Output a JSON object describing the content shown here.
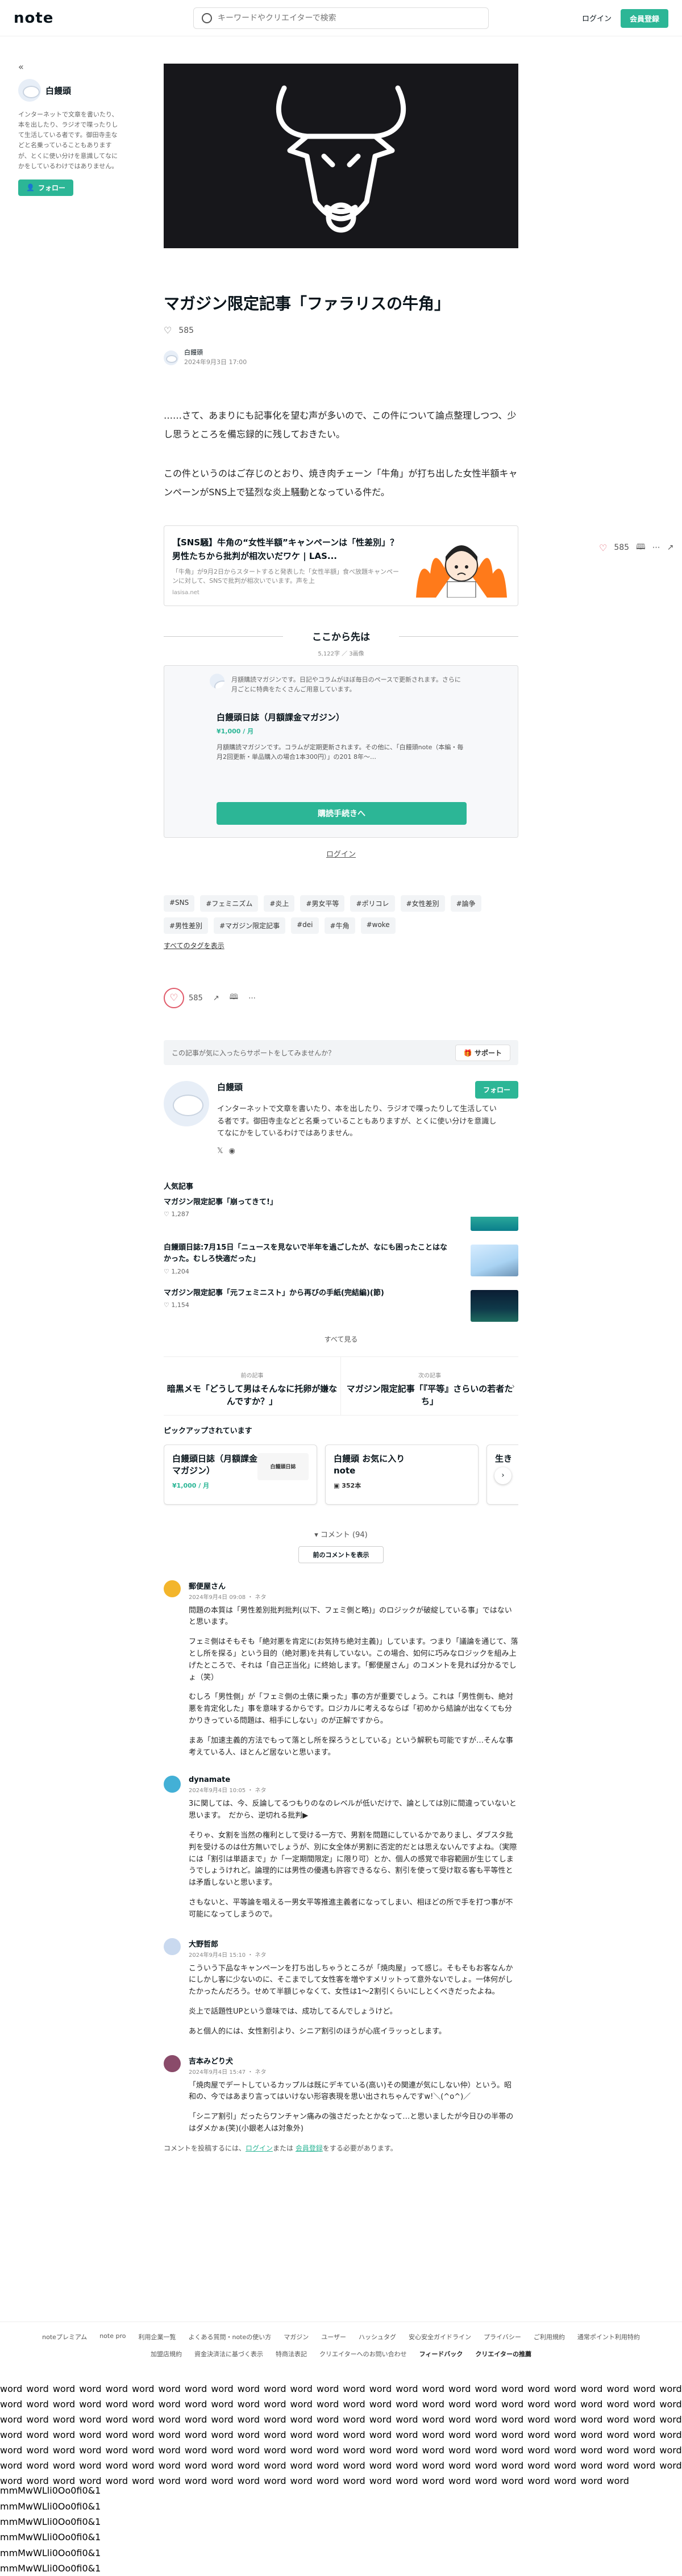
{
  "header": {
    "logo": "note",
    "search_placeholder": "キーワードやクリエイターで検索",
    "login": "ログイン",
    "register": "会員登録"
  },
  "sidebar": {
    "name": "白饅頭",
    "description": "インターネットで文章を書いたり、本を出したり、ラジオで喋ったりして生活している者です。御田寺圭などと名乗っていることもありますが、とくに使い分けを意識してなにかをしているわけではありません。",
    "follow": "フォロー"
  },
  "article": {
    "title": "マガジン限定記事「ファラリスの牛角」",
    "likes": "585",
    "author": "白饅頭",
    "date": "2024年9月3日 17:00",
    "paragraphs": [
      "……さて、あまりにも記事化を望む声が多いので、この件について論点整理しつつ、少し思うところを備忘録的に残しておきたい。",
      "この件というのはご存じのとおり、焼き肉チェーン「牛角」が打ち出した女性半額キャンペーンがSNS上で猛烈な炎上騒動となっている件だ。"
    ]
  },
  "embed": {
    "title": "【SNS騒】牛角の“女性半額”キャンペーンは「性差別」？ 男性たちから批判が相次いだワケ | LAS...",
    "description": "「牛角」が9月2日からスタートすると発表した「女性半額」食べ放題キャンペーンに対して、SNSで批判が相次いでいます。声を上",
    "source": "lasisa.net"
  },
  "paywall": {
    "title": "ここから先は",
    "stats": "5,122字 ／ 3画像",
    "note": "月額購読マガジンです。日記やコラムがほぼ毎日のペースで更新されます。さらに月ごとに特典をたくさんご用意しています。",
    "magazine_name": "白饅頭日誌（月額課金マガジン）",
    "price": "¥1,000 / 月",
    "magazine_desc": "月額購読マガジンです。コラムが定期更新されます。その他に、「白饅頭note（本編・毎月2回更新・単品購入の場合1本300円）」の201 8年～…",
    "subscribe": "購読手続きへ",
    "login": "ログイン"
  },
  "tags": [
    "#SNS",
    "#フェミニズム",
    "#炎上",
    "#男女平等",
    "#ポリコレ",
    "#女性差別",
    "#論争",
    "#男性差別",
    "#マガジン限定記事",
    "#dei",
    "#牛角",
    "#woke"
  ],
  "all_tags": "すべてのタグを表示",
  "actions": {
    "likes": "585"
  },
  "support": {
    "text": "この記事が気に入ったらサポートをしてみませんか？",
    "button": "サポート"
  },
  "creator": {
    "name": "白饅頭",
    "description": "インターネットで文章を書いたり、本を出したり、ラジオで喋ったりして生活している者です。御田寺圭などと名乗っていることもありますが、とくに使い分けを意識してなにかをしているわけではありません。",
    "follow": "フォロー"
  },
  "popular": {
    "title": "人気記事",
    "items": [
      {
        "title": "マガジン限定記事「崩ってきて!」",
        "likes": "1,287"
      },
      {
        "title": "白饅頭日誌:7月15日「ニュースを見ないで半年を過ごしたが、なにも困ったことはなかった。むしろ快適だった」",
        "likes": "1,204"
      },
      {
        "title": "マガジン限定記事「元フェミニスト」から再びの手紙(完結編)(節)",
        "likes": "1,154"
      }
    ],
    "see_all": "すべて見る"
  },
  "prevnext": {
    "prev_label": "前の記事",
    "prev_title": "暗黒メモ「どうして男はそんなに托卵が嫌なんですか？」",
    "next_label": "次の記事",
    "next_title": "マガジン限定記事「『平等』さらいの若者たち」"
  },
  "pickup": {
    "title": "ピックアップされています",
    "items": [
      {
        "title": "白饅頭日誌（月額課金マガジン）",
        "meta": "¥1,000 / 月",
        "thumb": "白饅頭日誌"
      },
      {
        "title": "白饅頭 お気に入りnote",
        "meta": "352本",
        "thumb": ""
      },
      {
        "title": "生き",
        "meta": "",
        "thumb": ""
      }
    ]
  },
  "comments": {
    "header": "コメント (94)",
    "prev": "前のコメントを表示",
    "items": [
      {
        "name": "郵便屋さん",
        "date": "2024年9月4日 09:08 ・ ネタ",
        "body": [
          "問題の本質は「男性差別批判批判(以下、フェミ側と略)」のロジックが破綻している事」ではないと思います。",
          "フェミ側はそもそも「絶対悪を肯定に(お気持ち絶対主義)」しています。つまり「議論を通じて、落とし所を探る」という目的（絶対悪)を共有していない。この場合、如何に巧みなロジックを組み上げたところで、それは「自己正当化」に終始します。「郵便屋さん」のコメントを見れば分かるでしょ（笑）",
          "むしろ「男性側」が「フェミ側の土俵に乗った」事の方が重要でしょう。これは「男性側も、絶対悪を肯定化した」事を意味するからです。ロジカルに考えるならば「初めから結論が出なくても分かりきっている問題は、相手にしない」のが正解ですから。",
          "まあ「加速主義的方法でもって落とし所を探ろうとしている」という解釈も可能ですが…そんな事考えている人、ほとんど居ないと思います。"
        ]
      },
      {
        "name": "dynamate",
        "date": "2024年9月4日 10:05 ・ ネタ",
        "body": [
          "3に関しては、今、反論してるつもりのなのレベルが低いだけで、論としては別に間違っていないと思います。　だから、逆切れる批判▶",
          "そりゃ、女割を当然の権利として受ける一方で、男割を問題にしているかでありまし、ダブスタ批判を受けるのは仕方無いでしょうが、別に女全体が男割に否定的だとは思えないんですよね。（実際には「割引は単語まで」か「一定期間限定」に限り可）とか、個人の感覚で非容範囲が生じてしまうでしょうけれど。論理的には男性の優遇も許容できるなら、割引を使って受け取る客も平等性とは矛盾しないと思います。",
          "さもないと、平等論を唱える一男女平等推進主義者になってしまい、相ほどの所で手を打つ事が不可能になってしまうので。"
        ]
      },
      {
        "name": "大野哲郎",
        "date": "2024年9月4日 15:10 ・ ネタ",
        "body": [
          "こういう下品なキャンペーンを打ち出しちゃうところが「焼肉屋」って感じ。そもそもお客なんかにしかし客に少ないのに、そこまでして女性客を増やすメリットって意外ないでしょ。一体何がしたかったんだろう。せめて半額じゃなくて、女性は1〜2割引くらいにしとくべきだったよね。",
          "炎上で話題性UPという意味では、成功してるんでしょうけど。",
          "あと個人的には、女性割引より、シニア割引のほうが心底イラッっとします。"
        ]
      },
      {
        "name": "吉本みどり犬",
        "date": "2024年9月4日 15:47 ・ ネタ",
        "body": [
          "「焼肉屋でデートしているカップルは既にデキている(高い)その関連が気にしない仲）という。昭和の、今ではあまり言ってはいけない形容表現を思い出されちゃんですw!＼(^o^)／",
          "「シニア割引」だったらワンチャン痛みの強さだったとかなって…と思いましたが今日ひの半帯のはダメかぁ(笑)(小銀老人は対象外)"
        ]
      }
    ],
    "footer_pre": "コメントを投稿するには、",
    "footer_login": "ログイン",
    "footer_mid": "または",
    "footer_register": "会員登録",
    "footer_post": "をする必要があります。"
  },
  "footer": {
    "row1": [
      "noteプレミアム",
      "note pro",
      "利用企業一覧",
      "よくある質問・noteの使い方",
      "マガジン",
      "ユーザー",
      "ハッシュタグ",
      "安心安全ガイドライン",
      "プライバシー",
      "ご利用規約",
      "通常ポイント利用特約"
    ],
    "row2": [
      "加盟店規約",
      "資金決済法に基づく表示",
      "特商法表記",
      "クリエイターへのお問い合わせ",
      "フィードバック",
      "クリエイターの推薦"
    ]
  },
  "filler": {
    "word": "word",
    "mm": "mmMwWLli0Oo0fi0&1"
  }
}
